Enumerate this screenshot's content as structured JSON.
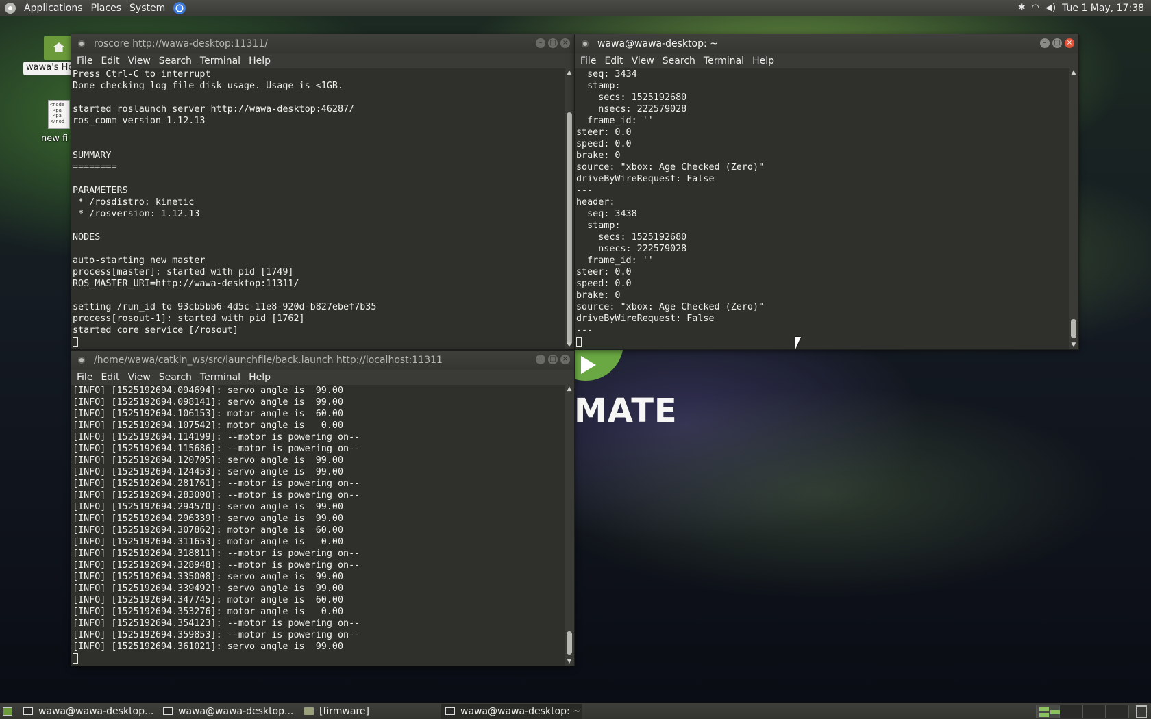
{
  "top_panel": {
    "menus": [
      "Applications",
      "Places",
      "System"
    ],
    "clock": "Tue  1 May, 17:38",
    "tray": {
      "bluetooth": "bluetooth-icon",
      "wifi": "wifi-icon",
      "volume": "volume-icon"
    }
  },
  "desktop": {
    "home_label": "wawa's Home",
    "file_label": "new file",
    "file_preview": "<node\n <pa\n <pa\n</nod",
    "watermark": "MATE"
  },
  "windows": {
    "roscore": {
      "title": "roscore http://wawa-desktop:11311/",
      "lines": [
        "Press Ctrl-C to interrupt",
        "Done checking log file disk usage. Usage is <1GB.",
        "",
        "started roslaunch server http://wawa-desktop:46287/",
        "ros_comm version 1.12.13",
        "",
        "",
        "SUMMARY",
        "========",
        "",
        "PARAMETERS",
        " * /rosdistro: kinetic",
        " * /rosversion: 1.12.13",
        "",
        "NODES",
        "",
        "auto-starting new master",
        "process[master]: started with pid [1749]",
        "ROS_MASTER_URI=http://wawa-desktop:11311/",
        "",
        "setting /run_id to 93cb5bb6-4d5c-11e8-920d-b827ebef7b35",
        "process[rosout-1]: started with pid [1762]",
        "started core service [/rosout]"
      ]
    },
    "home": {
      "title": "wawa@wawa-desktop: ~",
      "lines": [
        "  seq: 3434",
        "  stamp:",
        "    secs: 1525192680",
        "    nsecs: 222579028",
        "  frame_id: ''",
        "steer: 0.0",
        "speed: 0.0",
        "brake: 0",
        "source: \"xbox: Age Checked (Zero)\"",
        "driveByWireRequest: False",
        "---",
        "header:",
        "  seq: 3438",
        "  stamp:",
        "    secs: 1525192680",
        "    nsecs: 222579028",
        "  frame_id: ''",
        "steer: 0.0",
        "speed: 0.0",
        "brake: 0",
        "source: \"xbox: Age Checked (Zero)\"",
        "driveByWireRequest: False",
        "---"
      ]
    },
    "launch": {
      "title": "/home/wawa/catkin_ws/src/launchfile/back.launch http://localhost:11311",
      "lines": [
        "[INFO] [1525192694.094694]: servo angle is  99.00",
        "[INFO] [1525192694.098141]: servo angle is  99.00",
        "[INFO] [1525192694.106153]: motor angle is  60.00",
        "[INFO] [1525192694.107542]: motor angle is   0.00",
        "[INFO] [1525192694.114199]: --motor is powering on--",
        "[INFO] [1525192694.115686]: --motor is powering on--",
        "[INFO] [1525192694.120705]: servo angle is  99.00",
        "[INFO] [1525192694.124453]: servo angle is  99.00",
        "[INFO] [1525192694.281761]: --motor is powering on--",
        "[INFO] [1525192694.283000]: --motor is powering on--",
        "[INFO] [1525192694.294570]: servo angle is  99.00",
        "[INFO] [1525192694.296339]: servo angle is  99.00",
        "[INFO] [1525192694.307862]: motor angle is  60.00",
        "[INFO] [1525192694.311653]: motor angle is   0.00",
        "[INFO] [1525192694.318811]: --motor is powering on--",
        "[INFO] [1525192694.328948]: --motor is powering on--",
        "[INFO] [1525192694.335008]: servo angle is  99.00",
        "[INFO] [1525192694.339492]: servo angle is  99.00",
        "[INFO] [1525192694.347745]: motor angle is  60.00",
        "[INFO] [1525192694.353276]: motor angle is   0.00",
        "[INFO] [1525192694.354123]: --motor is powering on--",
        "[INFO] [1525192694.359853]: --motor is powering on--",
        "[INFO] [1525192694.361021]: servo angle is  99.00"
      ]
    }
  },
  "terminal_menu": [
    "File",
    "Edit",
    "View",
    "Search",
    "Terminal",
    "Help"
  ],
  "taskbar": [
    {
      "label": "wawa@wawa-desktop...",
      "icon": "terminal-icon"
    },
    {
      "label": "wawa@wawa-desktop...",
      "icon": "terminal-icon"
    },
    {
      "label": "[firmware]",
      "icon": "folder-icon"
    },
    {
      "label": "wawa@wawa-desktop: ~",
      "icon": "terminal-icon"
    }
  ]
}
